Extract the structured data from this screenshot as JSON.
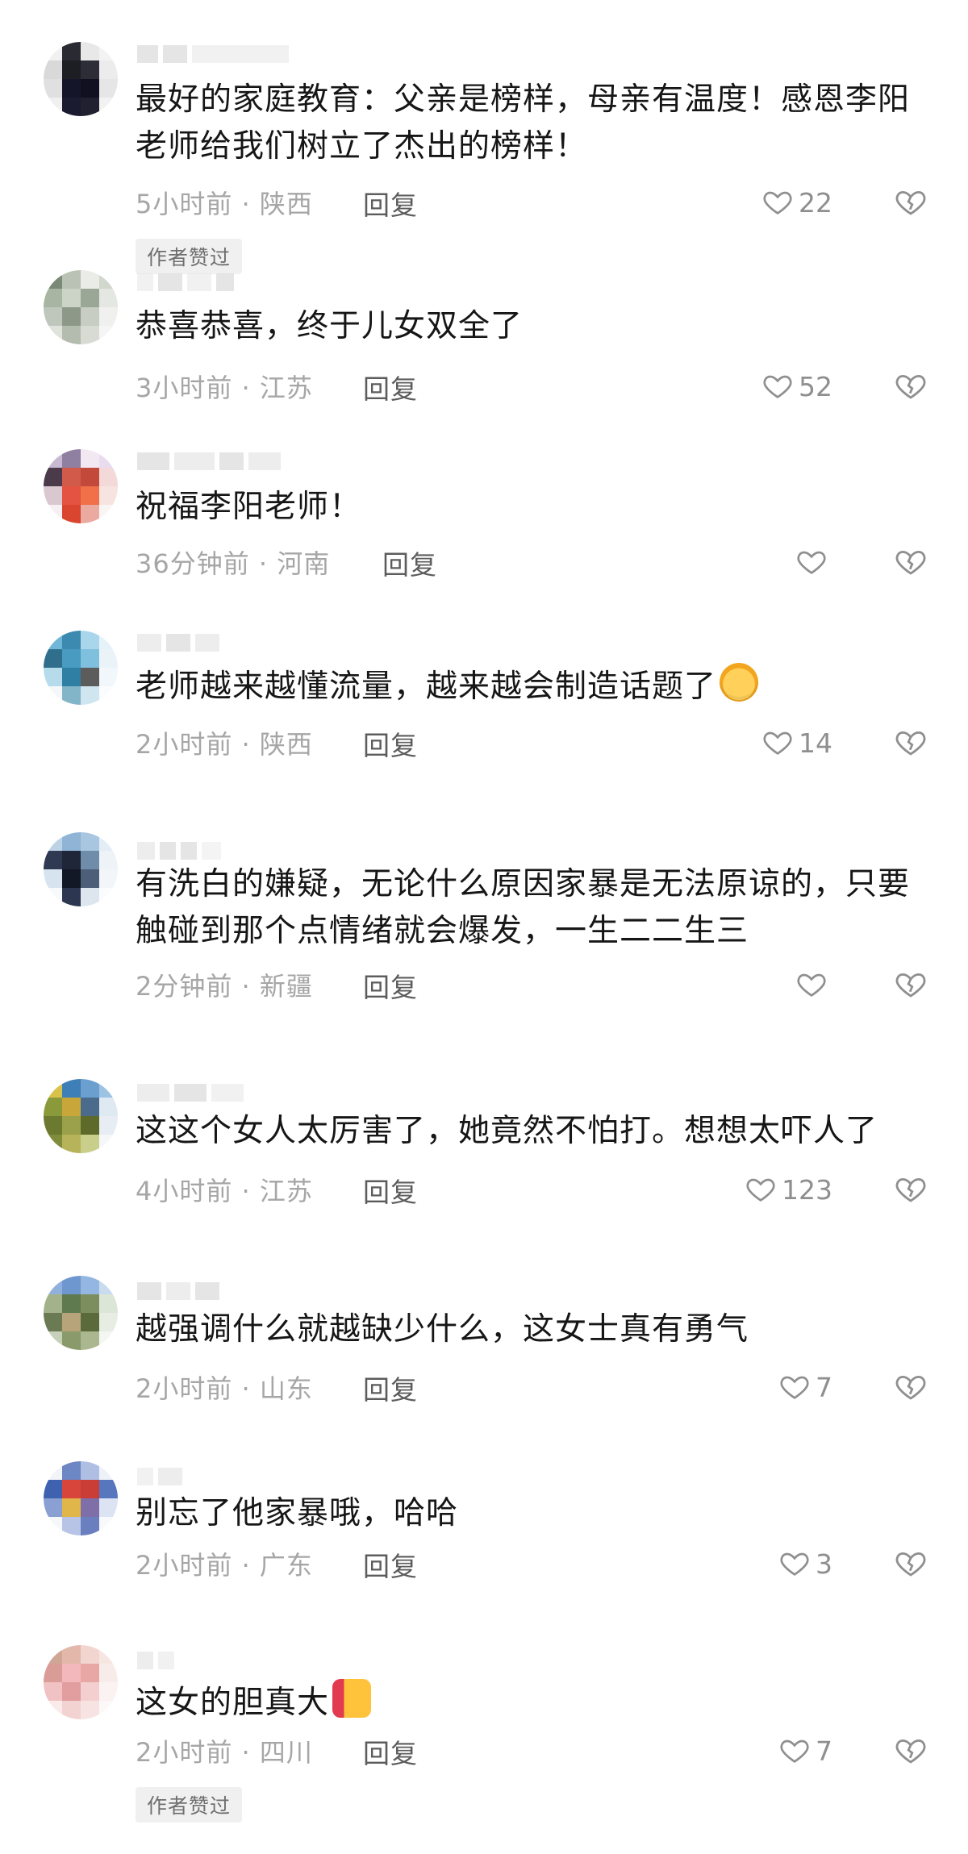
{
  "comments": [
    {
      "text": "最好的家庭教育：父亲是榜样，母亲有温度！感恩李阳老师给我们树立了杰出的榜样！",
      "time": "5小时前 · 陕西",
      "reply": "回复",
      "likes": "22",
      "badge": "作者赞过"
    },
    {
      "text": "恭喜恭喜，终于儿女双全了",
      "time": "3小时前 · 江苏",
      "reply": "回复",
      "likes": "52",
      "badge": ""
    },
    {
      "text": "祝福李阳老师！",
      "time": "36分钟前 · 河南",
      "reply": "回复",
      "likes": "",
      "badge": ""
    },
    {
      "text": "老师越来越懂流量，越来越会制造话题了",
      "time": "2小时前 · 陕西",
      "reply": "回复",
      "likes": "14",
      "badge": "",
      "emoji": "laughing-tears-emoji"
    },
    {
      "text": "有洗白的嫌疑，无论什么原因家暴是无法原谅的，只要触碰到那个点情绪就会爆发，一生二二生三",
      "time": "2分钟前 · 新疆",
      "reply": "回复",
      "likes": "",
      "badge": ""
    },
    {
      "text": "这这个女人太厉害了，她竟然不怕打。想想太吓人了",
      "time": "4小时前 · 江苏",
      "reply": "回复",
      "likes": "123",
      "badge": ""
    },
    {
      "text": "越强调什么就越缺少什么，这女士真有勇气",
      "time": "2小时前 · 山东",
      "reply": "回复",
      "likes": "7",
      "badge": ""
    },
    {
      "text": "别忘了他家暴哦，哈哈",
      "time": "2小时前 · 广东",
      "reply": "回复",
      "likes": "3",
      "badge": ""
    },
    {
      "text": "这女的胆真大",
      "time": "2小时前 · 四川",
      "reply": "回复",
      "likes": "7",
      "badge": "作者赞过",
      "emoji": "thumbs-up-emoji"
    }
  ],
  "icons": {
    "like": "heart-outline-icon",
    "dislike": "broken-heart-icon"
  },
  "colors": {
    "text": "#161616",
    "meta": "#a6a6a6",
    "reply": "#5c5c5c",
    "badge_bg": "#f0f0f0"
  }
}
